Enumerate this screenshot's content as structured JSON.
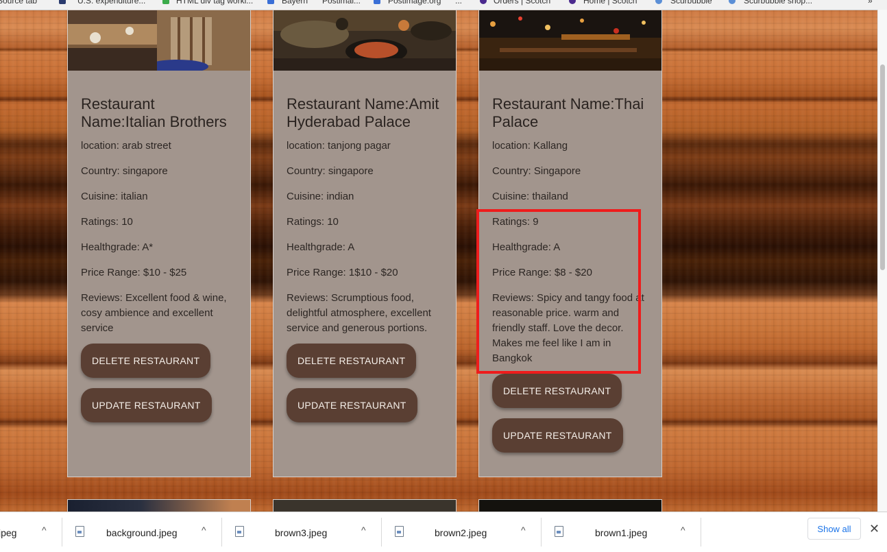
{
  "bookmarks": [
    {
      "label": "Source tab"
    },
    {
      "label": "U.S. expenditure..."
    },
    {
      "label": "HTML div tag worki..."
    },
    {
      "label": "Bayern"
    },
    {
      "label": "Postimal..."
    },
    {
      "label": "Postimage.org"
    },
    {
      "label": "..."
    },
    {
      "label": "Orders | Scotch"
    },
    {
      "label": "Home | Scotch"
    },
    {
      "label": "Scurbubble"
    },
    {
      "label": "Scurbubble shop..."
    }
  ],
  "restaurants": [
    {
      "name": "Restaurant Name:Italian Brothers",
      "location": "location: arab street",
      "country": "Country: singapore",
      "cuisine": "Cuisine: italian",
      "ratings": "Ratings: 10",
      "healthgrade": "Healthgrade: A*",
      "price": "Price Range: $10 - $25",
      "reviews": "Reviews: Excellent food & wine, cosy ambience and excellent service",
      "delete_label": "DELETE RESTAURANT",
      "update_label": "UPDATE RESTAURANT"
    },
    {
      "name": "Restaurant Name:Amit Hyderabad Palace",
      "location": "location: tanjong pagar",
      "country": "Country: singapore",
      "cuisine": "Cuisine: indian",
      "ratings": "Ratings: 10",
      "healthgrade": "Healthgrade: A",
      "price": "Price Range: 1$10 - $20",
      "reviews": "Reviews: Scrumptious food, delightful atmosphere, excellent service and generous portions.",
      "delete_label": "DELETE RESTAURANT",
      "update_label": "UPDATE RESTAURANT"
    },
    {
      "name": "Restaurant Name:Thai Palace",
      "location": "location: Kallang",
      "country": "Country: Singapore",
      "cuisine": "Cuisine: thailand",
      "ratings": "Ratings: 9",
      "healthgrade": "Healthgrade: A",
      "price": "Price Range: $8 - $20",
      "reviews": "Reviews: Spicy and tangy food at reasonable price. warm and friendly staff. Love the decor. Makes me feel like I am in Bangkok",
      "delete_label": "DELETE RESTAURANT",
      "update_label": "UPDATE RESTAURANT"
    }
  ],
  "downloads": {
    "items": [
      {
        "name": "jpeg"
      },
      {
        "name": "background.jpeg"
      },
      {
        "name": "brown3.jpeg"
      },
      {
        "name": "brown2.jpeg"
      },
      {
        "name": "brown1.jpeg"
      }
    ],
    "show_all_label": "Show all",
    "close_glyph": "✕",
    "chevron_glyph": "^"
  },
  "colors": {
    "card_bg": "#a2958d",
    "button_bg": "#5a3f33",
    "highlight": "#ee1c1c"
  }
}
